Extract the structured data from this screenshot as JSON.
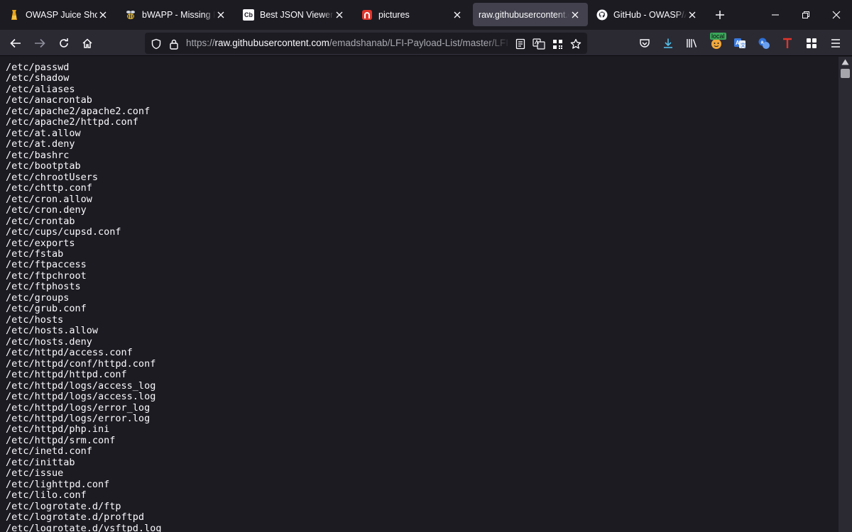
{
  "tabs": [
    {
      "title": "OWASP Juice Shop",
      "icon": "juice-shop-icon"
    },
    {
      "title": "bWAPP - Missing Func",
      "icon": "bee-icon"
    },
    {
      "title": "Best JSON Viewer and",
      "icon": "codebeautify-icon",
      "icon_text": "Cb"
    },
    {
      "title": "pictures",
      "icon": "arch-red-icon"
    },
    {
      "title": "raw.githubusercontent.com",
      "icon": "none",
      "selected": true
    },
    {
      "title": "GitHub - OWASP/Ama",
      "icon": "github-icon"
    }
  ],
  "url": {
    "scheme": "https://",
    "host": "raw.githubusercontent.com",
    "path": "/emadshanab/LFI-Payload-List/master/LFI payload"
  },
  "toolbar": {
    "local_badge": "local"
  },
  "colors": {
    "tab_bar_bg": "#1c1b22",
    "toolbar_bg": "#2b2a33",
    "selected_tab_bg": "#42414d",
    "download_accent": "#54bfe8",
    "translate_blue": "#3a7be0",
    "red_t": "#e0352b"
  },
  "content_lines": [
    "/etc/passwd",
    "/etc/shadow",
    "/etc/aliases",
    "/etc/anacrontab",
    "/etc/apache2/apache2.conf",
    "/etc/apache2/httpd.conf",
    "/etc/at.allow",
    "/etc/at.deny",
    "/etc/bashrc",
    "/etc/bootptab",
    "/etc/chrootUsers",
    "/etc/chttp.conf",
    "/etc/cron.allow",
    "/etc/cron.deny",
    "/etc/crontab",
    "/etc/cups/cupsd.conf",
    "/etc/exports",
    "/etc/fstab",
    "/etc/ftpaccess",
    "/etc/ftpchroot",
    "/etc/ftphosts",
    "/etc/groups",
    "/etc/grub.conf",
    "/etc/hosts",
    "/etc/hosts.allow",
    "/etc/hosts.deny",
    "/etc/httpd/access.conf",
    "/etc/httpd/conf/httpd.conf",
    "/etc/httpd/httpd.conf",
    "/etc/httpd/logs/access_log",
    "/etc/httpd/logs/access.log",
    "/etc/httpd/logs/error_log",
    "/etc/httpd/logs/error.log",
    "/etc/httpd/php.ini",
    "/etc/httpd/srm.conf",
    "/etc/inetd.conf",
    "/etc/inittab",
    "/etc/issue",
    "/etc/lighttpd.conf",
    "/etc/lilo.conf",
    "/etc/logrotate.d/ftp",
    "/etc/logrotate.d/proftpd",
    "/etc/logrotate.d/vsftpd.log"
  ]
}
